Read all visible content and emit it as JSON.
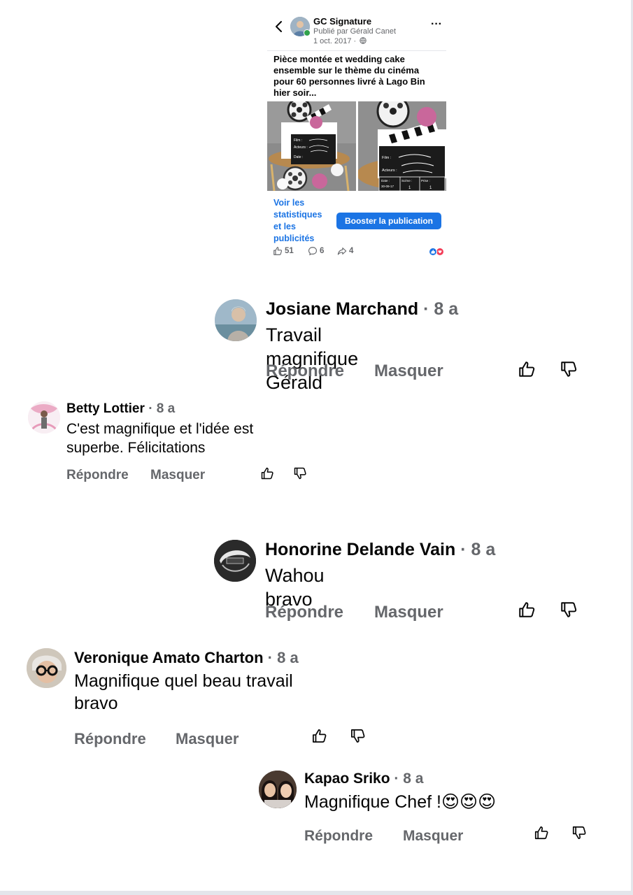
{
  "post": {
    "page_name": "GC Signature",
    "published_by": "Publié par Gérald Canet",
    "date": "1 oct. 2017 ·",
    "text": "Pièce montée et wedding cake ensemble sur le thème du cinéma pour 60 personnes livré à Lago Bin hier soir...",
    "clapper_left": {
      "film": "Film :",
      "acteurs": "Acteurs :",
      "date": "Date :"
    },
    "clapper_right": {
      "film": "Film :",
      "acteurs": "Acteurs :",
      "date": "Date :",
      "date_value": "30-09-17",
      "scene": "Scène :",
      "scene_value": "1",
      "prise": "Prise :",
      "prise_value": "1"
    },
    "stats_link": "Voir les statistiques et les publicités",
    "boost_label": "Booster la publication",
    "likes": "51",
    "comments": "6",
    "shares": "4"
  },
  "comments": [
    {
      "name": "Josiane Marchand",
      "time": "· 8 a",
      "text": "Travail magnifique Gérald",
      "reply": "Répondre",
      "hide": "Masquer"
    },
    {
      "name": "Betty Lottier",
      "time": "· 8 a",
      "text": "C'est magnifique et l'idée est superbe. Félicitations",
      "reply": "Répondre",
      "hide": "Masquer"
    },
    {
      "name": "Honorine Delande Vain",
      "time": "· 8 a",
      "text": "Wahou bravo",
      "reply": "Répondre",
      "hide": "Masquer"
    },
    {
      "name": "Veronique Amato Charton",
      "time": "· 8 a",
      "text": "Magnifique quel beau travail bravo",
      "reply": "Répondre",
      "hide": "Masquer"
    },
    {
      "name": "Kapao Sriko",
      "time": "· 8 a",
      "text": "Magnifique Chef !😍😍😍",
      "reply": "Répondre",
      "hide": "Masquer"
    }
  ],
  "icons": {
    "back": "chevron-left-icon",
    "more": "more-options-icon",
    "globe": "globe-icon",
    "like": "thumbs-up-icon",
    "comment": "comment-bubble-icon",
    "share": "share-arrow-icon",
    "dislike": "thumbs-down-icon"
  },
  "colors": {
    "accent": "#1b74e4",
    "muted": "#65676b",
    "online": "#31a24c",
    "love": "#f33e58"
  }
}
